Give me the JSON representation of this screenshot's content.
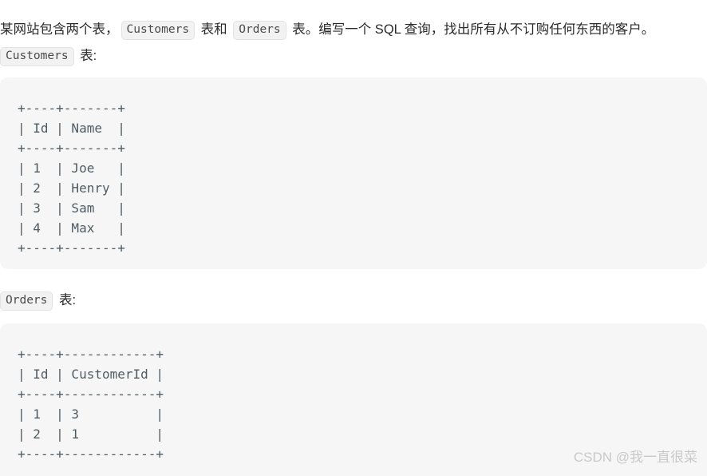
{
  "document": {
    "intro": {
      "part1": "某网站包含两个表，",
      "code1": "Customers",
      "part2": " 表和 ",
      "code2": "Orders",
      "part3": " 表。编写一个 SQL 查询，找出所有从不订购任何东西的客户。"
    },
    "sections": [
      {
        "code_label": "Customers",
        "label_suffix": " 表:",
        "table_text": "+----+-------+\n| Id | Name  |\n+----+-------+\n| 1  | Joe   |\n| 2  | Henry |\n| 3  | Sam   |\n| 4  | Max   |\n+----+-------+"
      },
      {
        "code_label": "Orders",
        "label_suffix": " 表:",
        "table_text": "+----+------------+\n| Id | CustomerId |\n+----+------------+\n| 1  | 3          |\n| 2  | 1          |\n+----+------------+"
      }
    ],
    "watermark": "CSDN @我一直很菜"
  },
  "tables": {
    "customers": {
      "name": "Customers",
      "columns": [
        "Id",
        "Name"
      ],
      "rows": [
        [
          "1",
          "Joe"
        ],
        [
          "2",
          "Henry"
        ],
        [
          "3",
          "Sam"
        ],
        [
          "4",
          "Max"
        ]
      ]
    },
    "orders": {
      "name": "Orders",
      "columns": [
        "Id",
        "CustomerId"
      ],
      "rows": [
        [
          "1",
          "3"
        ],
        [
          "2",
          "1"
        ]
      ]
    }
  },
  "colors": {
    "page_background": "#ffffff",
    "code_background": "#f6f6f6",
    "code_text": "#4f5b62",
    "body_text": "#2b2b2b",
    "chip_background": "#f2f2f2",
    "chip_border": "#e3e3e3",
    "watermark_text": "#c9c9c9"
  }
}
